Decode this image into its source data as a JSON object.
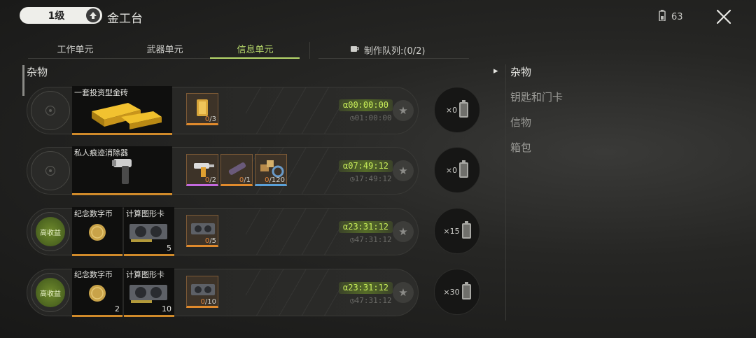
{
  "header": {
    "level": "1级",
    "title": "金工台",
    "energy": "63"
  },
  "tabs": [
    {
      "label": "工作单元",
      "active": false
    },
    {
      "label": "武器单元",
      "active": false
    },
    {
      "label": "信息单元",
      "active": true
    }
  ],
  "queue": {
    "label": "制作队列:(0/2)"
  },
  "section": {
    "label": "杂物"
  },
  "rows": [
    {
      "badge": "",
      "products": [
        {
          "name": "一套投资型金砖",
          "count": ""
        }
      ],
      "materials": [
        {
          "have": "0",
          "need": "/3"
        }
      ],
      "timer": {
        "alpha": "α00:00:00",
        "base": "01:00:00"
      },
      "queue_count": "×0"
    },
    {
      "badge": "",
      "products": [
        {
          "name": "私人痕迹消除器",
          "count": ""
        }
      ],
      "materials": [
        {
          "have": "0",
          "need": "/2"
        },
        {
          "have": "0",
          "need": "/1"
        },
        {
          "have": "0",
          "need": "/120"
        }
      ],
      "timer": {
        "alpha": "α07:49:12",
        "base": "17:49:12"
      },
      "queue_count": "×0"
    },
    {
      "badge": "高收益",
      "products": [
        {
          "name": "纪念数字币",
          "count": ""
        },
        {
          "name": "计算图形卡",
          "count": "5"
        }
      ],
      "materials": [
        {
          "have": "0",
          "need": "/5"
        }
      ],
      "timer": {
        "alpha": "α23:31:12",
        "base": "47:31:12"
      },
      "queue_count": "×15"
    },
    {
      "badge": "高收益",
      "products": [
        {
          "name": "纪念数字币",
          "count": "2"
        },
        {
          "name": "计算图形卡",
          "count": "10"
        }
      ],
      "materials": [
        {
          "have": "0",
          "need": "/10"
        }
      ],
      "timer": {
        "alpha": "α23:31:12",
        "base": "47:31:12"
      },
      "queue_count": "×30"
    }
  ],
  "sidebar": {
    "items": [
      {
        "label": "杂物",
        "active": true
      },
      {
        "label": "钥匙和门卡",
        "active": false
      },
      {
        "label": "信物",
        "active": false
      },
      {
        "label": "箱包",
        "active": false
      }
    ]
  },
  "colors": {
    "accent_green": "#b7d96b",
    "timer_green": "#c9ef5a",
    "rarity_orange": "#d08a2a",
    "rarity_purple": "#c46adf",
    "rarity_blue": "#5aa0d8"
  },
  "icons": [
    "arrow-up-icon",
    "battery-icon",
    "close-icon",
    "cup-icon",
    "star-icon",
    "clock-icon",
    "chevron-right-icon"
  ]
}
